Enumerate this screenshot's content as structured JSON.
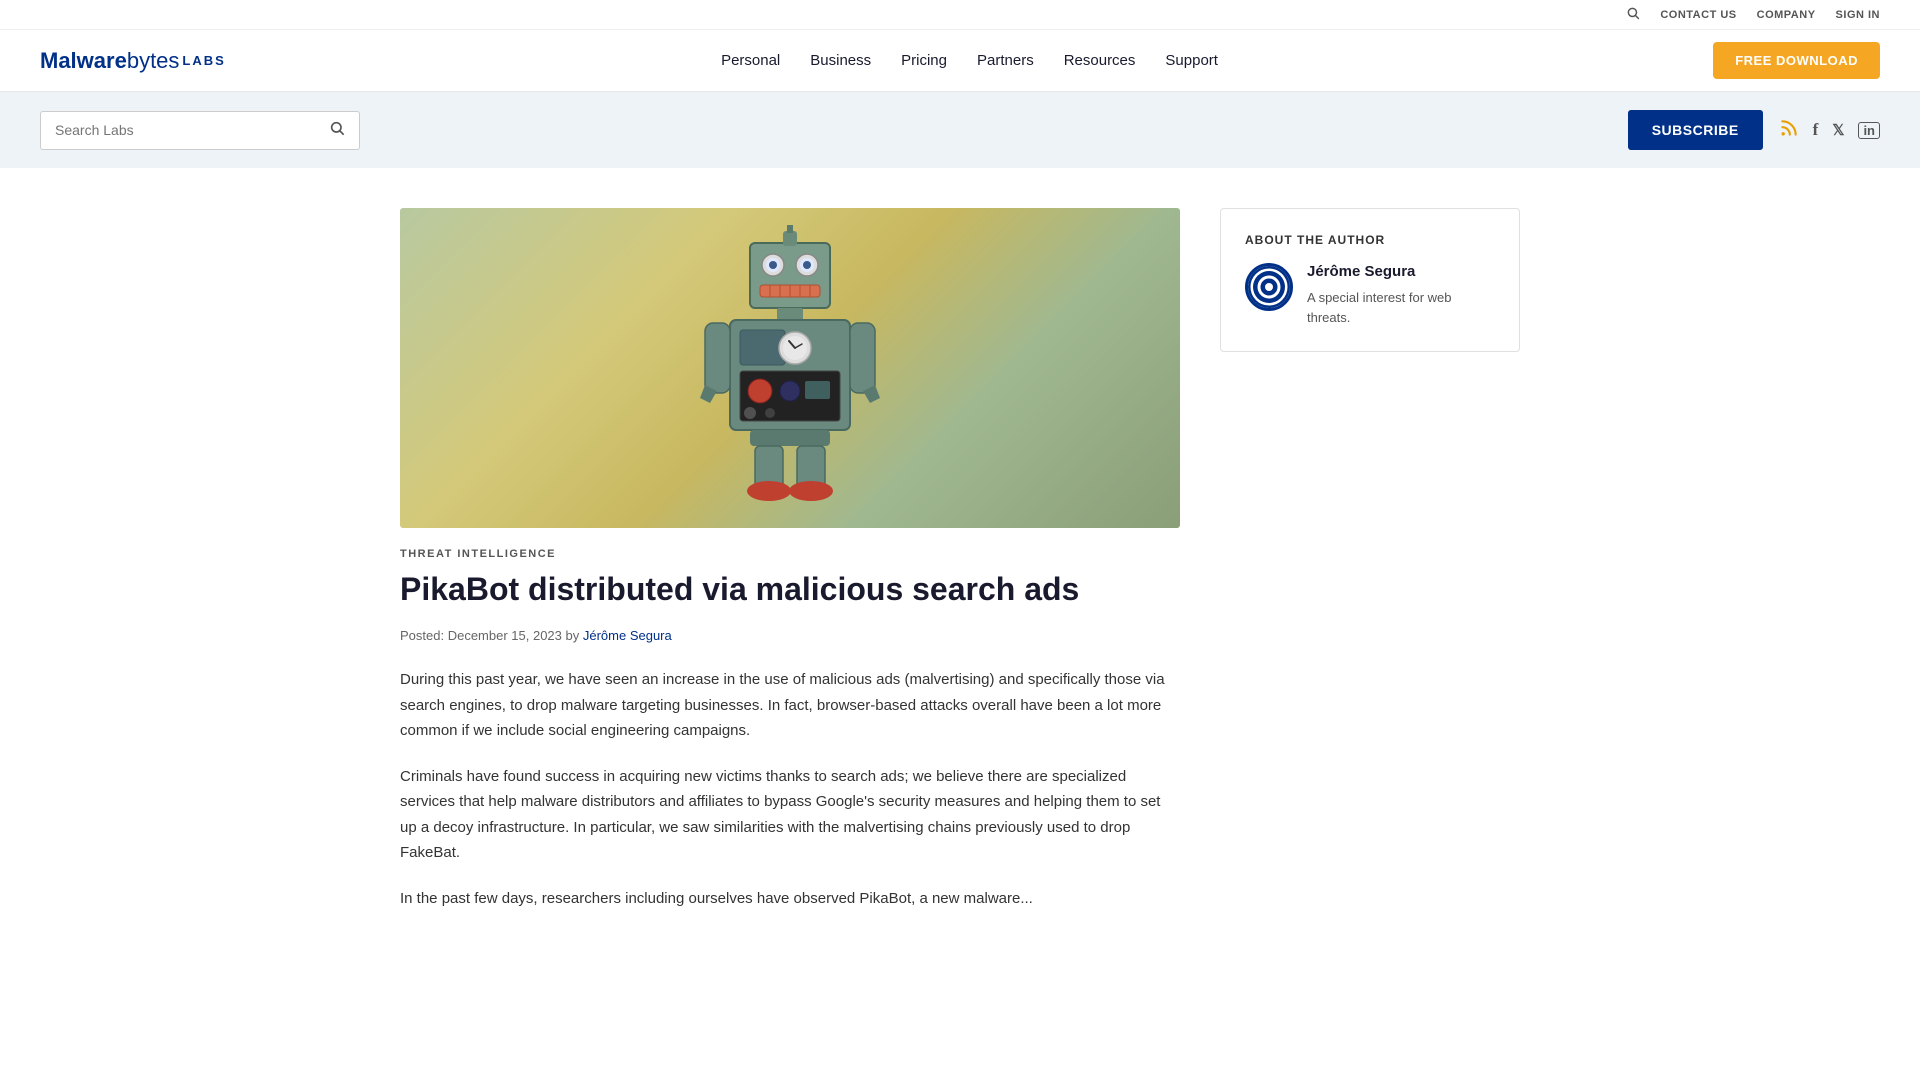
{
  "topbar": {
    "contact_us": "CONTACT US",
    "company": "COMPANY",
    "sign_in": "SIGN IN"
  },
  "nav": {
    "logo_malware": "Malware",
    "logo_bytes": "bytes",
    "logo_labs": "LABS",
    "links": [
      {
        "label": "Personal",
        "id": "personal"
      },
      {
        "label": "Business",
        "id": "business"
      },
      {
        "label": "Pricing",
        "id": "pricing"
      },
      {
        "label": "Partners",
        "id": "partners"
      },
      {
        "label": "Resources",
        "id": "resources"
      },
      {
        "label": "Support",
        "id": "support"
      }
    ],
    "free_download": "FREE DOWNLOAD"
  },
  "search_section": {
    "placeholder": "Search Labs",
    "subscribe_label": "SUBSCRIBE"
  },
  "article": {
    "category": "THREAT INTELLIGENCE",
    "title": "PikaBot distributed via malicious search ads",
    "meta": "Posted: December 15, 2023 by",
    "author_link": "Jérôme Segura",
    "body_1": "During this past year, we have seen an increase in the use of malicious ads (malvertising) and specifically those via search engines, to drop malware targeting businesses. In fact, browser-based attacks overall have been a lot more common if we include social engineering campaigns.",
    "body_2": "Criminals have found success in acquiring new victims thanks to search ads; we believe there are specialized services that help malware distributors and affiliates to bypass Google's security measures and helping them to set up a decoy infrastructure. In particular, we saw similarities with the malvertising chains previously used to drop FakeBat.",
    "body_3": "In the past few days, researchers including ourselves have observed PikaBot, a new malware..."
  },
  "sidebar": {
    "author_section_title": "ABOUT THE AUTHOR",
    "author_name": "Jérôme Segura",
    "author_bio": "A special interest for web threats."
  },
  "icons": {
    "search": "⌕",
    "rss": "RSS",
    "facebook": "f",
    "twitter": "𝕏",
    "linkedin": "in"
  }
}
